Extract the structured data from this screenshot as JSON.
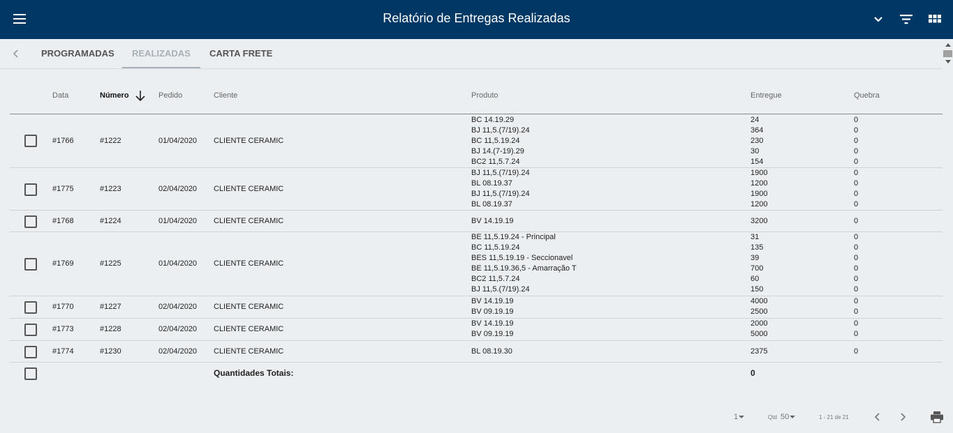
{
  "header": {
    "title": "Relatório de Entregas Realizadas"
  },
  "tabs": [
    {
      "label": "PROGRAMADAS"
    },
    {
      "label": "REALIZADAS"
    },
    {
      "label": "CARTA FRETE"
    }
  ],
  "table": {
    "columns": {
      "data": "Data",
      "numero": "Número",
      "pedido": "Pedido",
      "cliente": "Cliente",
      "produto": "Produto",
      "entregue": "Entregue",
      "quebra": "Quebra"
    },
    "rows": [
      {
        "data": "#1766",
        "numero": "#1222",
        "pedido": "01/04/2020",
        "cliente": "CLIENTE CERAMIC",
        "produtos": [
          "BC 14.19.29",
          "BJ 11,5.(7/19).24",
          "BC 11,5.19.24",
          "BJ 14.(7-19).29",
          "BC2 11,5.7.24"
        ],
        "entregue": [
          "24",
          "364",
          "230",
          "30",
          "154"
        ],
        "quebra": [
          "0",
          "0",
          "0",
          "0",
          "0"
        ]
      },
      {
        "data": "#1775",
        "numero": "#1223",
        "pedido": "02/04/2020",
        "cliente": "CLIENTE CERAMIC",
        "produtos": [
          "BJ 11,5.(7/19).24",
          "BL 08.19.37",
          "BJ 11,5.(7/19).24",
          "BL 08.19.37"
        ],
        "entregue": [
          "1900",
          "1200",
          "1900",
          "1200"
        ],
        "quebra": [
          "0",
          "0",
          "0",
          "0"
        ]
      },
      {
        "data": "#1768",
        "numero": "#1224",
        "pedido": "01/04/2020",
        "cliente": "CLIENTE CERAMIC",
        "produtos": [
          "BV 14.19.19"
        ],
        "entregue": [
          "3200"
        ],
        "quebra": [
          "0"
        ]
      },
      {
        "data": "#1769",
        "numero": "#1225",
        "pedido": "01/04/2020",
        "cliente": "CLIENTE CERAMIC",
        "produtos": [
          "BE 11,5.19.24 - Principal",
          "BC 11,5.19.24",
          "BES 11,5.19.19 - Seccionavel",
          "BE 11,5.19.36,5 - Amarração T",
          "BC2 11,5.7.24",
          "BJ 11,5.(7/19).24"
        ],
        "entregue": [
          "31",
          "135",
          "39",
          "700",
          "60",
          "150"
        ],
        "quebra": [
          "0",
          "0",
          "0",
          "0",
          "0",
          "0"
        ]
      },
      {
        "data": "#1770",
        "numero": "#1227",
        "pedido": "02/04/2020",
        "cliente": "CLIENTE CERAMIC",
        "produtos": [
          "BV 14.19.19",
          "BV 09.19.19"
        ],
        "entregue": [
          "4000",
          "2500"
        ],
        "quebra": [
          "0",
          "0"
        ]
      },
      {
        "data": "#1773",
        "numero": "#1228",
        "pedido": "02/04/2020",
        "cliente": "CLIENTE CERAMIC",
        "produtos": [
          "BV 14.19.19",
          "BV 09.19.19"
        ],
        "entregue": [
          "2000",
          "5000"
        ],
        "quebra": [
          "0",
          "0"
        ]
      },
      {
        "data": "#1774",
        "numero": "#1230",
        "pedido": "02/04/2020",
        "cliente": "CLIENTE CERAMIC",
        "produtos": [
          "BL 08.19.30"
        ],
        "entregue": [
          "2375"
        ],
        "quebra": [
          "0"
        ]
      }
    ],
    "totals": {
      "label": "Quantidades Totais:",
      "value": "0"
    }
  },
  "footer": {
    "page": "1",
    "qtd_label": "Qtd",
    "qtd_value": "50",
    "range": "1 - 21 de 21"
  }
}
